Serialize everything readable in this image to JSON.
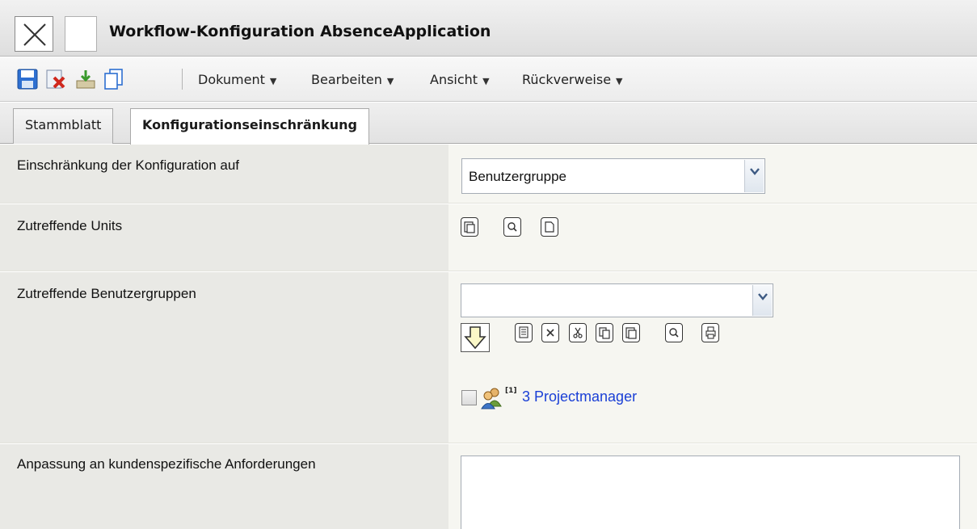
{
  "window": {
    "title": "Workflow-Konfiguration AbsenceApplication"
  },
  "toolbar": {
    "icons": [
      "save-icon",
      "delete-icon",
      "export-icon",
      "copy-icon"
    ],
    "menus": [
      {
        "label": "Dokument"
      },
      {
        "label": "Bearbeiten"
      },
      {
        "label": "Ansicht"
      },
      {
        "label": "Rückverweise"
      }
    ],
    "menu_arrow": "▼"
  },
  "tabs": [
    {
      "label": "Stammblatt",
      "active": false
    },
    {
      "label": "Konfigurationseinschränkung",
      "active": true
    }
  ],
  "form": {
    "restriction": {
      "label": "Einschränkung der Konfiguration auf",
      "selected": "Benutzergruppe"
    },
    "units": {
      "label": "Zutreffende Units"
    },
    "usergroups": {
      "label": "Zutreffende Benutzergruppen",
      "selected": "",
      "items": [
        {
          "index": "[1]",
          "name": "3 Projectmanager"
        }
      ]
    },
    "customization": {
      "label": "Anpassung an kundenspezifische Anforderungen",
      "value": ""
    }
  },
  "colors": {
    "link": "#1a3fd6",
    "label_bg": "#e9e9e5",
    "field_bg": "#f6f6f1"
  }
}
